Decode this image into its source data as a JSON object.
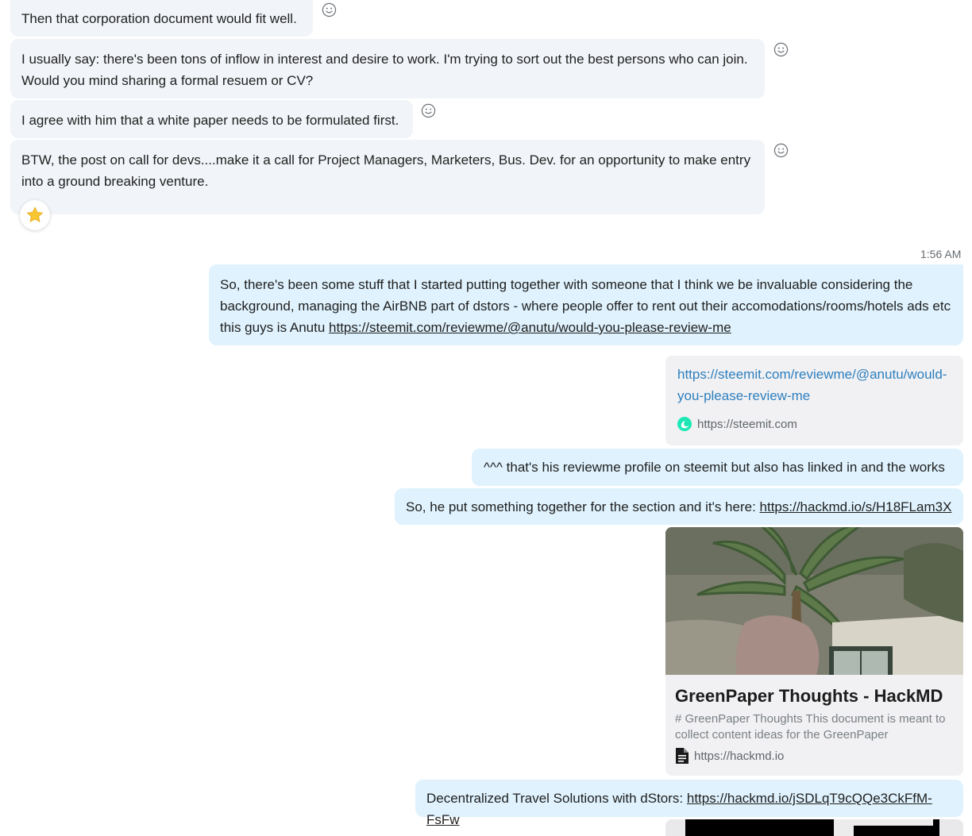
{
  "messages_in": [
    {
      "text": "Then that corporation document would fit well."
    },
    {
      "text": "I usually say: there's been tons of inflow in interest and desire to work. I'm trying to sort out the best persons who can join. Would you mind sharing a formal resuem or CV?"
    },
    {
      "text": "I agree with him that a white paper needs to be formulated first."
    },
    {
      "text": "BTW, the post on call for devs....make it a call for Project Managers, Marketers, Bus. Dev. for an opportunity to make entry into a ground breaking venture."
    }
  ],
  "reaction": {
    "icon": "star-icon",
    "color": "#f7c631"
  },
  "timestamp": "1:56 AM",
  "messages_out": [
    {
      "text": "So, there's been some stuff that I started putting together with someone that I think we be invaluable considering the background, managing the AirBNB part of dstors - where people offer to rent out their accomodations/rooms/hotels ads etc this guys is Anutu ",
      "link": "https://steemit.com/reviewme/@anutu/would-you-please-review-me"
    },
    {
      "text": "^^^ that's his reviewme profile on steemit but also has linked in and the works"
    },
    {
      "text": "So, he put something together for the section and it's here: ",
      "link": "https://hackmd.io/s/H18FLam3X"
    },
    {
      "text": "Decentralized Travel Solutions with dStors: ",
      "link": "https://hackmd.io/jSDLqT9cQQe3CkFfM-FsFw"
    }
  ],
  "link_card_steemit": {
    "url": "https://steemit.com/reviewme/@anutu/would-you-please-review-me",
    "site": "https://steemit.com",
    "icon": "steemit-logo-icon"
  },
  "link_card_hackmd": {
    "title": "GreenPaper Thoughts - HackMD",
    "description": "# GreenPaper Thoughts  This document is meant to collect content ideas for the GreenPaper (WhitePape",
    "site": "https://hackmd.io",
    "icon": "document-icon"
  },
  "colors": {
    "incoming_bubble": "#f1f4f8",
    "outgoing_bubble": "#dff2fd",
    "link_card_url": "#2d7fbe"
  }
}
